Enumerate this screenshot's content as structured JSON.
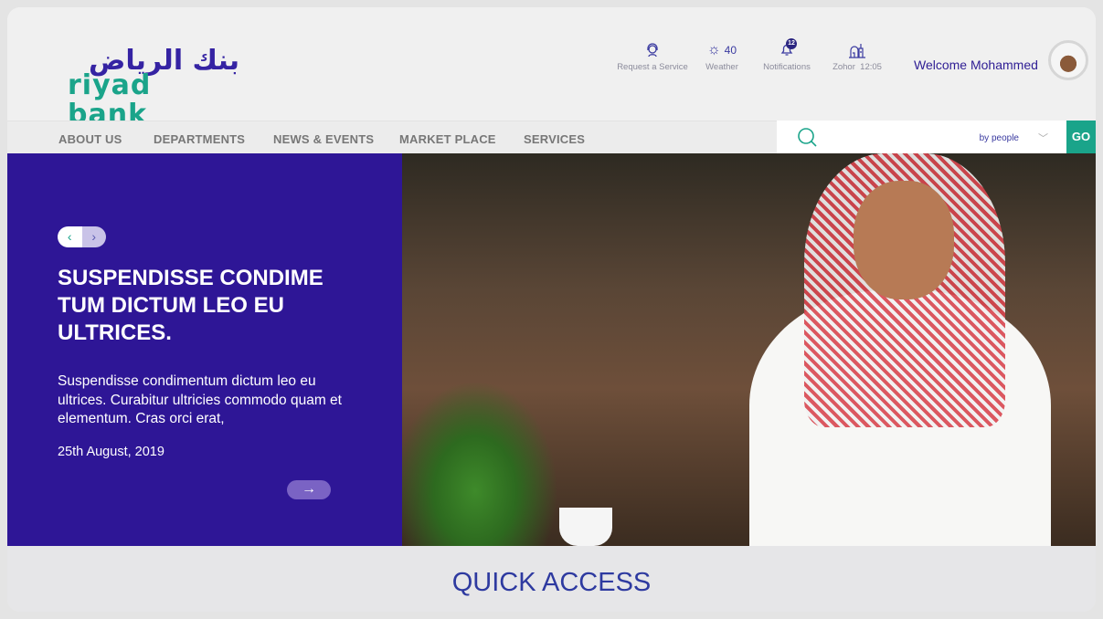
{
  "brand": {
    "arabic": "بنك الرياض",
    "english": "riyad bank",
    "colors": {
      "primary": "#2e1696",
      "accent": "#1aa48a"
    }
  },
  "utilities": [
    {
      "icon": "headset-icon",
      "label": "Request a Service",
      "value": ""
    },
    {
      "icon": "sun-icon",
      "label": "Weather",
      "value": "40"
    },
    {
      "icon": "bell-icon",
      "label": "Notifications",
      "badge": "12"
    },
    {
      "icon": "mosque-icon",
      "label": "Zohor  12:05"
    }
  ],
  "user": {
    "welcome": "Welcome Mohammed"
  },
  "nav": [
    "ABOUT US",
    "DEPARTMENTS",
    "NEWS & EVENTS",
    "MARKET PLACE",
    "SERVICES"
  ],
  "search": {
    "placeholder": "",
    "filter": "by people",
    "go": "GO"
  },
  "hero": {
    "title": "SUSPENDISSE CONDIME TUM DICTUM LEO EU ULTRICES.",
    "description": "Suspendisse condimentum dictum leo eu ultrices. Curabitur ultricies commodo quam et elementum. Cras orci erat,",
    "date": "25th August, 2019"
  },
  "quick_access": {
    "title": "QUICK ACCESS"
  }
}
